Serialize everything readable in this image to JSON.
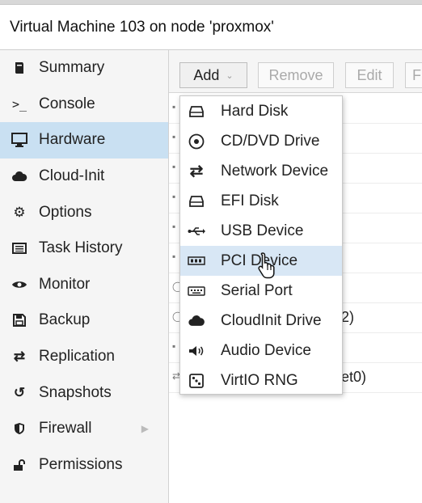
{
  "window": {
    "title": "Virtual Machine 103 on node 'proxmox'"
  },
  "sidebar": {
    "items": [
      {
        "label": "Summary"
      },
      {
        "label": "Console"
      },
      {
        "label": "Hardware"
      },
      {
        "label": "Cloud-Init"
      },
      {
        "label": "Options"
      },
      {
        "label": "Task History"
      },
      {
        "label": "Monitor"
      },
      {
        "label": "Backup"
      },
      {
        "label": "Replication"
      },
      {
        "label": "Snapshots"
      },
      {
        "label": "Firewall"
      },
      {
        "label": "Permissions"
      }
    ],
    "active": "Hardware"
  },
  "toolbar": {
    "add": "Add",
    "remove": "Remove",
    "edit": "Edit",
    "extra": "F"
  },
  "background_rows": {
    "row8_value": "2)",
    "row10_value": "et0)"
  },
  "add_menu": {
    "items": [
      {
        "label": "Hard Disk"
      },
      {
        "label": "CD/DVD Drive"
      },
      {
        "label": "Network Device"
      },
      {
        "label": "EFI Disk"
      },
      {
        "label": "USB Device"
      },
      {
        "label": "PCI Device"
      },
      {
        "label": "Serial Port"
      },
      {
        "label": "CloudInit Drive"
      },
      {
        "label": "Audio Device"
      },
      {
        "label": "VirtIO RNG"
      }
    ],
    "hovered": "PCI Device"
  },
  "colors": {
    "active_nav": "#c9e0f2",
    "menu_hover": "#d8e7f5"
  }
}
